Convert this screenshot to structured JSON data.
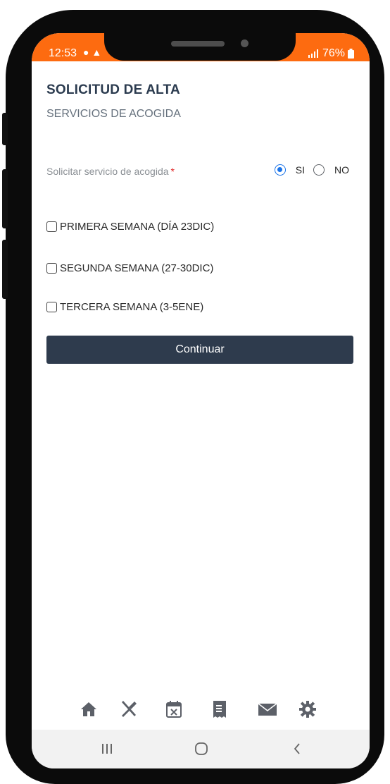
{
  "status_bar": {
    "time": "12:53",
    "battery": "76%",
    "background": "#fd6b10"
  },
  "header": {
    "title": "SOLICITUD DE ALTA",
    "subtitle": "SERVICIOS DE ACOGIDA"
  },
  "form": {
    "question_label": "Solicitar servicio de acogida",
    "required_mark": "*",
    "options": [
      {
        "label": "SI",
        "selected": true
      },
      {
        "label": "NO",
        "selected": false
      }
    ],
    "checkboxes": [
      {
        "label": "PRIMERA SEMANA (DÍA 23DIC)",
        "checked": false
      },
      {
        "label": "SEGUNDA SEMANA (27-30DIC)",
        "checked": false
      },
      {
        "label": "TERCERA SEMANA (3-5ENE)",
        "checked": false
      }
    ],
    "continue_label": "Continuar"
  },
  "bottom_nav": {
    "icons": [
      "home-icon",
      "cutlery-icon",
      "calendar-cancel-icon",
      "receipt-icon",
      "mail-icon",
      "gear-icon"
    ]
  },
  "system_nav": {
    "icons": [
      "recent-apps-icon",
      "home-circle-icon",
      "back-icon"
    ]
  },
  "colors": {
    "primary_button": "#2e3b4d",
    "radio_accent": "#1a73e8",
    "required": "#e02424"
  }
}
